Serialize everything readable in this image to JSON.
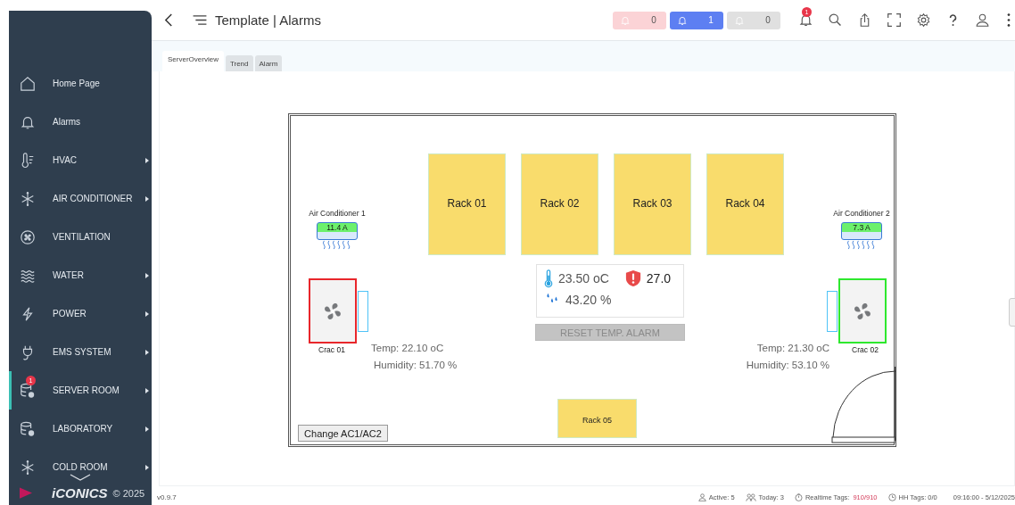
{
  "sidebar": {
    "items": [
      {
        "label": "Home Page",
        "has_submenu": false,
        "selected": false
      },
      {
        "label": "Alarms",
        "has_submenu": false,
        "selected": false
      },
      {
        "label": "HVAC",
        "has_submenu": true,
        "selected": false
      },
      {
        "label": "AIR CONDITIONER",
        "has_submenu": true,
        "selected": false
      },
      {
        "label": "VENTILATION",
        "has_submenu": false,
        "selected": false
      },
      {
        "label": "WATER",
        "has_submenu": true,
        "selected": false
      },
      {
        "label": "POWER",
        "has_submenu": true,
        "selected": false
      },
      {
        "label": "EMS SYSTEM",
        "has_submenu": true,
        "selected": false
      },
      {
        "label": "SERVER ROOM",
        "has_submenu": true,
        "selected": true,
        "badge": "1"
      },
      {
        "label": "LABORATORY",
        "has_submenu": true,
        "selected": false
      },
      {
        "label": "COLD ROOM",
        "has_submenu": true,
        "selected": false
      }
    ],
    "logo": "iCONICS",
    "copyright": "© 2025"
  },
  "header": {
    "title": "Template | Alarms",
    "alarm_counters": [
      {
        "count": "0",
        "color": "#fbd3d6"
      },
      {
        "count": "1",
        "color": "#5d7ff2"
      },
      {
        "count": "0",
        "color": "#e0e0e0"
      }
    ],
    "notification_badge": "1"
  },
  "tabs": [
    {
      "label": "ServerOverview",
      "selected": true
    },
    {
      "label": "Trend",
      "selected": false
    },
    {
      "label": "Alarm",
      "selected": false
    }
  ],
  "floor_plan": {
    "racks": [
      "Rack 01",
      "Rack 02",
      "Rack 03",
      "Rack 04",
      "Rack 05"
    ],
    "air_conditioners": [
      {
        "label": "Air Conditioner 1",
        "current": "11.4 A"
      },
      {
        "label": "Air Conditioner 2",
        "current": "7.3 A"
      }
    ],
    "cracs": [
      {
        "label": "Crac 01",
        "color": "#e8262b",
        "temp": "Temp:  22.10 oC",
        "humidity": "Humidity:  51.70 %"
      },
      {
        "label": "Crac 02",
        "color": "#2ee82e",
        "temp": "Temp:  21.30 oC",
        "humidity": "Humidity:  53.10 %"
      }
    ],
    "sensor": {
      "temperature": "23.50 oC",
      "alarm_setpoint": "27.0",
      "humidity": "43.20 %"
    },
    "reset_button": {
      "label": "RESET TEMP. ALARM",
      "disabled": true
    },
    "change_button": "Change AC1/AC2"
  },
  "status_bar": {
    "version": "v0.9.7",
    "active": "Active: 5",
    "today": "Today: 3",
    "realtime_label": "Realtime Tags:",
    "realtime_value": "910/910",
    "hh_tags": "HH Tags: 0/0",
    "time_range": "09:16:00 - 5/12/2025"
  }
}
